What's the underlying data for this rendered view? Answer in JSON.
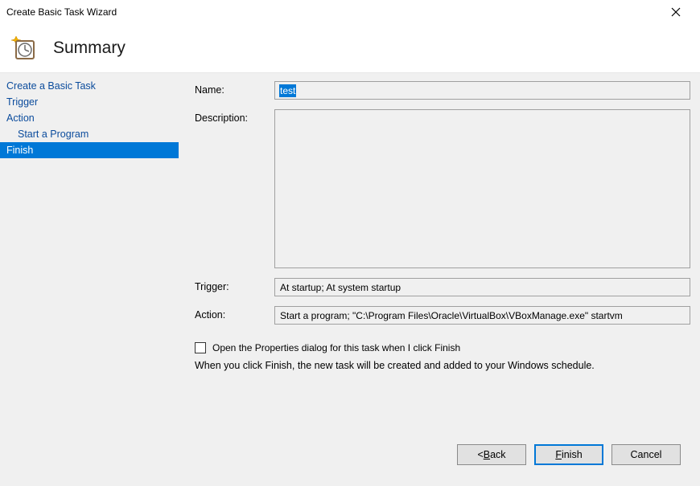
{
  "window": {
    "title": "Create Basic Task Wizard"
  },
  "header": {
    "title": "Summary"
  },
  "sidebar": {
    "items": [
      {
        "label": "Create a Basic Task",
        "indent": false,
        "selected": false
      },
      {
        "label": "Trigger",
        "indent": false,
        "selected": false
      },
      {
        "label": "Action",
        "indent": false,
        "selected": false
      },
      {
        "label": "Start a Program",
        "indent": true,
        "selected": false
      },
      {
        "label": "Finish",
        "indent": false,
        "selected": true
      }
    ]
  },
  "form": {
    "name_label": "Name:",
    "name_value": "test",
    "description_label": "Description:",
    "description_value": "",
    "trigger_label": "Trigger:",
    "trigger_value": "At startup; At system startup",
    "action_label": "Action:",
    "action_value": "Start a program; \"C:\\Program Files\\Oracle\\VirtualBox\\VBoxManage.exe\" startvm"
  },
  "extras": {
    "open_properties_label": "Open the Properties dialog for this task when I click Finish",
    "open_properties_checked": false,
    "hint": "When you click Finish, the new task will be created and added to your Windows schedule."
  },
  "buttons": {
    "back_prefix": "< ",
    "back_mn": "B",
    "back_rest": "ack",
    "finish_mn": "F",
    "finish_rest": "inish",
    "cancel": "Cancel"
  }
}
